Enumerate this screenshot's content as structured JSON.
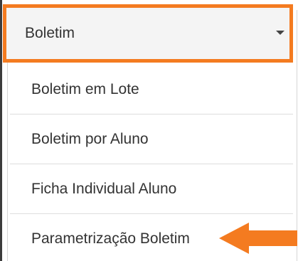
{
  "menu": {
    "header_label": "Boletim",
    "items": [
      {
        "label": "Boletim em Lote"
      },
      {
        "label": "Boletim por Aluno"
      },
      {
        "label": "Ficha Individual Aluno"
      },
      {
        "label": "Parametrização Boletim"
      }
    ]
  },
  "colors": {
    "highlight": "#f47b20",
    "text": "#333333",
    "divider": "#dedede"
  },
  "icons": {
    "dropdown": "caret-down-icon",
    "pointer": "orange-arrow-left-icon"
  }
}
